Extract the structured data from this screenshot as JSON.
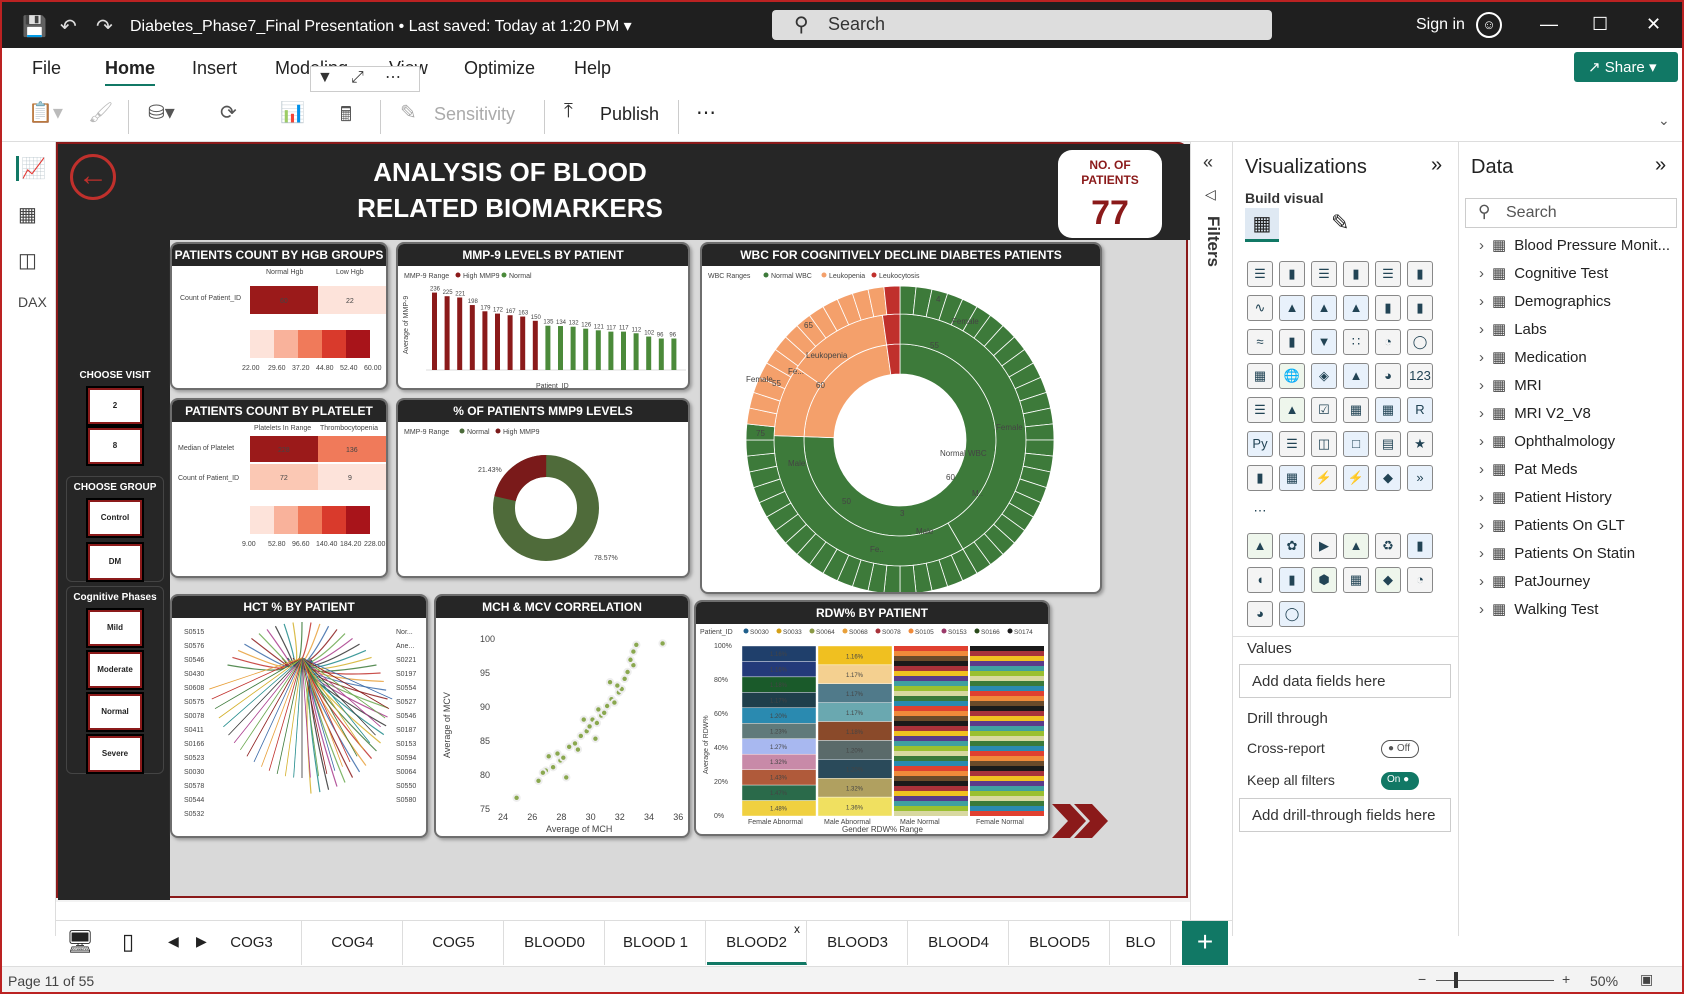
{
  "app": {
    "doc_title": "Diabetes_Phase7_Final Presentation",
    "saved": "Last saved: Today at 1:20 PM",
    "search_placeholder": "Search",
    "sign_in": "Sign in",
    "share": "Share"
  },
  "menu": [
    "File",
    "Home",
    "Insert",
    "Modeling",
    "View",
    "Optimize",
    "Help"
  ],
  "ribbon": {
    "sensitivity": "Sensitivity",
    "publish": "Publish"
  },
  "report": {
    "title_line1": "ANALYSIS OF BLOOD",
    "title_line2": "RELATED BIOMARKERS",
    "patients_label_1": "NO. OF",
    "patients_label_2": "PATIENTS",
    "patients_value": "77",
    "slicers": {
      "visit_title": "CHOOSE VISIT",
      "visits": [
        "2",
        "8"
      ],
      "group_title": "CHOOSE GROUP",
      "groups": [
        "Control",
        "DM"
      ],
      "phase_title": "Cognitive Phases",
      "phases": [
        "Mild",
        "Moderate",
        "Normal",
        "Severe"
      ]
    },
    "visuals": {
      "hgb": {
        "title": "PATIENTS COUNT BY HGB GROUPS",
        "cols": [
          "Normal Hgb",
          "Low Hgb"
        ],
        "row": "Count of Patient_ID",
        "values": [
          "60",
          "22"
        ],
        "scale": [
          "22.00",
          "29.60",
          "37.20",
          "44.80",
          "52.40",
          "60.00"
        ]
      },
      "mmp9": {
        "title": "MMP-9 LEVELS BY PATIENT",
        "legend_title": "MMP-9 Range",
        "legend": [
          "High MMP9",
          "Normal"
        ],
        "ylabel": "Average of MMP-9",
        "xlabel": "Patient_ID",
        "values": [
          236,
          225,
          221,
          198,
          179,
          172,
          167,
          163,
          150,
          135,
          134,
          132,
          126,
          121,
          117,
          117,
          112,
          102,
          96,
          96
        ]
      },
      "wbc": {
        "title": "WBC FOR COGNITIVELY DECLINE DIABETES PATIENTS",
        "legend_title": "WBC Ranges",
        "legend": [
          "Normal WBC",
          "Leukopenia",
          "Leukocytosis"
        ],
        "labels": [
          "Female",
          "55",
          "Female",
          "65",
          "Male",
          "70",
          "Normal WBC",
          "60",
          "Male",
          "Fe..",
          "50",
          "Male",
          "75",
          "Female",
          "55",
          "Leukopenia",
          "60",
          "Fe...",
          "65",
          "Fe..",
          "4",
          "3",
          "M.."
        ]
      },
      "platelet": {
        "title": "PATIENTS COUNT BY PLATELET RANGE",
        "cols": [
          "Platelets In Range",
          "Thrombocytopenia"
        ],
        "rows": [
          "Median of Platelet",
          "Count of Patient_ID"
        ],
        "values": [
          "228",
          "136",
          "72",
          "9"
        ],
        "scale": [
          "9.00",
          "52.80",
          "96.60",
          "140.40",
          "184.20",
          "228.00"
        ]
      },
      "mmp9_pct": {
        "title": "% OF PATIENTS MMP9 LEVELS",
        "legend_title": "MMP-9 Range",
        "legend": [
          "Normal",
          "High MMP9"
        ],
        "values": [
          "21.43%",
          "78.57%"
        ]
      },
      "hct": {
        "title": "HCT % BY PATIENT",
        "left": [
          "S0515",
          "S0576",
          "S0546",
          "S0430",
          "S0608",
          "S0575",
          "S0078",
          "S0411",
          "S0166",
          "S0523",
          "S0030",
          "S0578",
          "S0544",
          "S0532"
        ],
        "right": [
          "Nor...",
          "Ane...",
          "S0221",
          "S0197",
          "S0554",
          "S0527",
          "S0546",
          "S0187",
          "S0153",
          "S0594",
          "S0064",
          "S0550",
          "S0580"
        ]
      },
      "mch": {
        "title": "MCH & MCV CORRELATION",
        "xlabel": "Average of MCH",
        "ylabel": "Average of MCV",
        "xticks": [
          "24",
          "26",
          "28",
          "30",
          "32",
          "34",
          "36"
        ],
        "yticks": [
          "100",
          "95",
          "90",
          "85",
          "80",
          "75"
        ]
      },
      "rdw": {
        "title": "RDW% BY PATIENT",
        "legend_title": "Patient_ID",
        "legend": [
          "S0030",
          "S0033",
          "S0064",
          "S0068",
          "S0078",
          "S0105",
          "S0153",
          "S0166",
          "S0174"
        ],
        "ylabel": "Average of RDW%",
        "xlabel": "Gender RDW% Range",
        "cats": [
          "Female Abnormal",
          "Male Abnormal",
          "Male Normal",
          "Female Normal"
        ],
        "yticks": [
          "100%",
          "80%",
          "60%",
          "40%",
          "20%",
          "0%"
        ],
        "col1": [
          "1.16%",
          "1.16%",
          "1.18%",
          "1.17%",
          "1.20%",
          "1.23%",
          "1.27%",
          "1.32%",
          "1.43%",
          "1.47%",
          "1.48%"
        ],
        "col2": [
          "1.16%",
          "1.17%",
          "1.17%",
          "1.17%",
          "1.18%",
          "1.20%",
          "1.20%",
          "1.32%",
          "1.36%"
        ]
      }
    }
  },
  "filters_label": "Filters",
  "viz_pane": {
    "title": "Visualizations",
    "build": "Build visual",
    "values_label": "Values",
    "values_field": "Add data fields here",
    "drill": "Drill through",
    "cross_report": "Cross-report",
    "cross_state": "Off",
    "keep_filters": "Keep all filters",
    "keep_state": "On",
    "drill_field": "Add drill-through fields here"
  },
  "data_pane": {
    "title": "Data",
    "search": "Search",
    "tables": [
      "Blood Pressure Monit...",
      "Cognitive Test",
      "Demographics",
      "Labs",
      "Medication",
      "MRI",
      "MRI V2_V8",
      "Ophthalmology",
      "Pat Meds",
      "Patient History",
      "Patients On GLT",
      "Patients On Statin",
      "PatJourney",
      "Walking Test"
    ]
  },
  "tabs": [
    "COG3",
    "COG4",
    "COG5",
    "BLOOD0",
    "BLOOD 1",
    "BLOOD2",
    "BLOOD3",
    "BLOOD4",
    "BLOOD5",
    "BLO"
  ],
  "active_tab": "BLOOD2",
  "status": {
    "page": "Page 11 of 55",
    "zoom": "50%"
  },
  "colors": {
    "accent": "#117865",
    "dark_red": "#8b1a1a",
    "green": "#3d7a3a",
    "orange": "#f4a06b"
  }
}
